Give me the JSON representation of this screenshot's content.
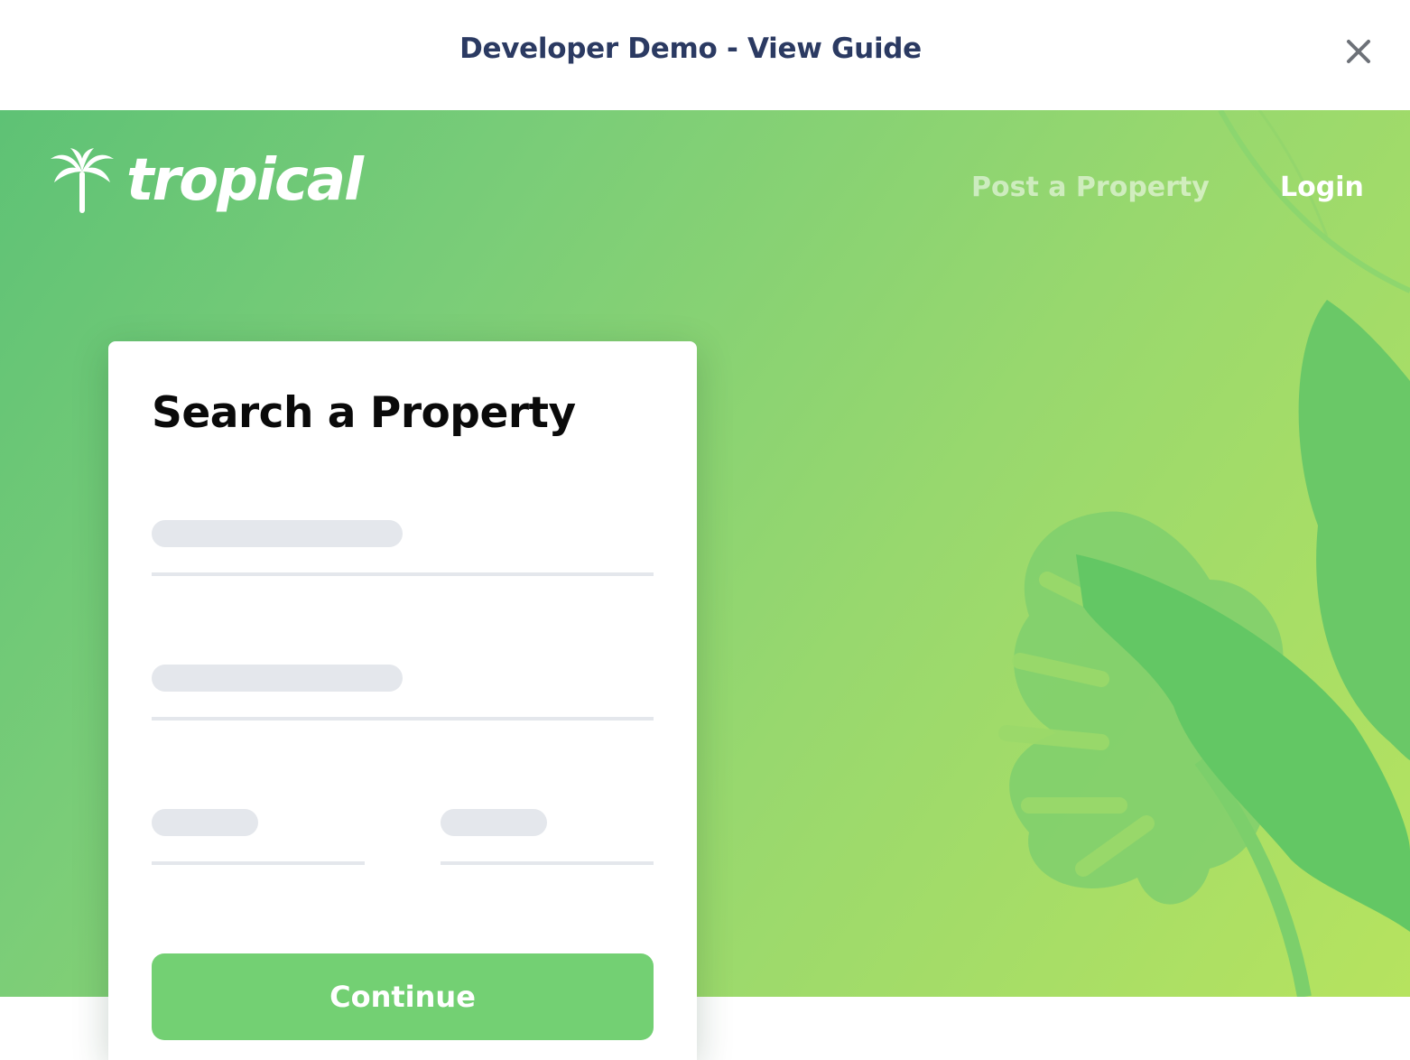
{
  "guide_bar": {
    "title": "Developer Demo - View Guide",
    "close_icon": "close-icon"
  },
  "header": {
    "logo_text": "tropical",
    "logo_icon": "palm-tree-icon",
    "nav": {
      "post_property": "Post a Property",
      "login": "Login"
    }
  },
  "search_card": {
    "title": "Search a Property",
    "continue_label": "Continue"
  },
  "colors": {
    "title_navy": "#2b3a62",
    "accent_green": "#73d073",
    "skeleton_gray": "#e4e7ec",
    "hero_gradient_start": "#5ec275",
    "hero_gradient_end": "#b6e35f"
  }
}
